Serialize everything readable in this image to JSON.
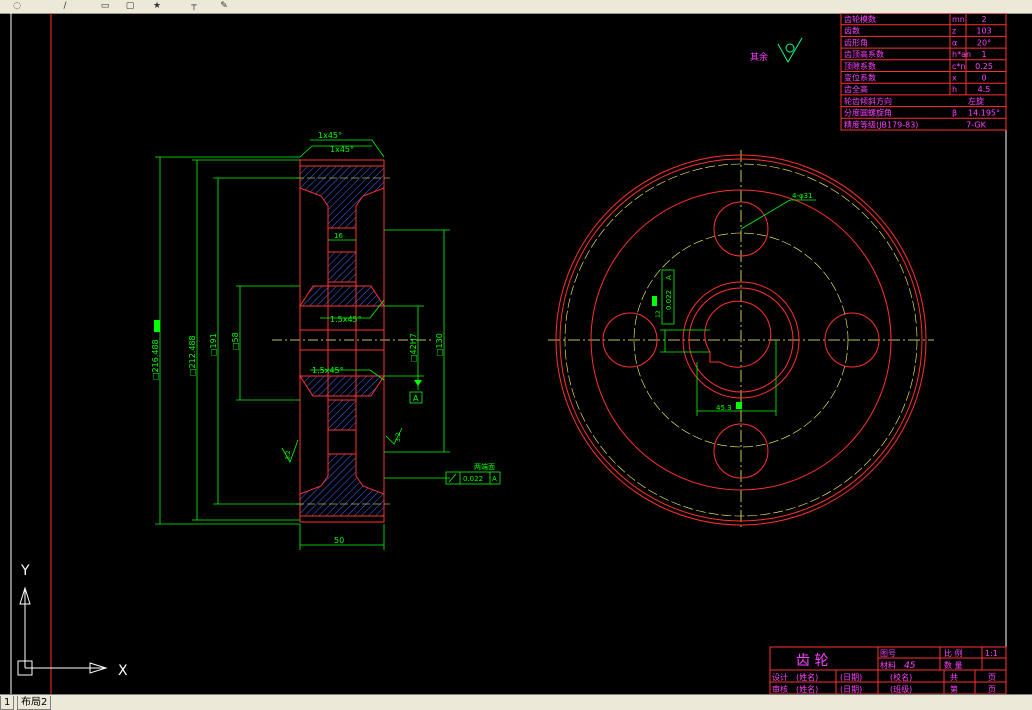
{
  "toolbar": {
    "buttons": [
      "zoom-icon",
      "pen-icon",
      "doc-icon",
      "copy-icon",
      "star-icon",
      "cursor-icon",
      "paint-icon"
    ]
  },
  "params_table": {
    "rows": [
      {
        "name": "齿轮模数",
        "sym": "mn",
        "val": "2"
      },
      {
        "name": "齿数",
        "sym": "z",
        "val": "103"
      },
      {
        "name": "齿形角",
        "sym": "α",
        "val": "20°"
      },
      {
        "name": "齿顶高系数",
        "sym": "h*an",
        "val": "1"
      },
      {
        "name": "顶隙系数",
        "sym": "c*n",
        "val": "0.25"
      },
      {
        "name": "变位系数",
        "sym": "x",
        "val": "0"
      },
      {
        "name": "齿全高",
        "sym": "h",
        "val": "4.5"
      },
      {
        "name": "轮齿倾斜方向",
        "sym": "",
        "val": "左旋"
      },
      {
        "name": "分度圆螺旋角",
        "sym": "β",
        "val": "14.195°"
      },
      {
        "name": "精度等级(JB179-83)",
        "sym": "",
        "val": "7-GK"
      }
    ]
  },
  "roughness_note": {
    "label": "其余",
    "value": ""
  },
  "section_view": {
    "chamfer_top1": "1x45°",
    "chamfer_top2": "1x45°",
    "chamfer_mid1": "1.5x45°",
    "chamfer_mid2": "1.5x45°",
    "dim_216": "□216.488",
    "dim_212": "□212.488",
    "dim_191": "□191",
    "dim_58": "□58",
    "dim_42": "□42H7",
    "dim_130": "□130",
    "dim_16": "16",
    "dim_50": "50",
    "datum": "A",
    "tol_label": "两端面",
    "tol_value": "0.022",
    "tol_datum": "A",
    "rough_left": "3.2",
    "rough_right": "3.2"
  },
  "front_view": {
    "hole_callout": "4-φ31",
    "keyway_dim": "45.3",
    "keyway_tol": "0.022",
    "keyway_datum": "A",
    "keyway_width": "12"
  },
  "title_block": {
    "title": "齿 轮",
    "drawing_no_label": "图号",
    "scale_label": "比 例",
    "scale_value": "1:1",
    "material_label": "材料",
    "material_value": "45",
    "qty_label": "数 量",
    "designer_label": "设计",
    "designer_name": "(姓名)",
    "date1": "(日期)",
    "checker_label": "审核",
    "checker_name": "(姓名)",
    "date2": "(日期)",
    "school": "(校名)",
    "class": "(班级)",
    "total_label": "共",
    "total_unit": "页",
    "page_label": "第",
    "page_unit": "页"
  },
  "ucs": {
    "x_label": "X",
    "y_label": "Y"
  },
  "tabs": {
    "tab1": "1",
    "tab2": "布局2"
  },
  "colors": {
    "red": "#ff2020",
    "green": "#00ff00",
    "yellow": "#ffff66",
    "magenta": "#ff40ff",
    "white": "#ffffff",
    "cyan": "#00c8ff"
  }
}
